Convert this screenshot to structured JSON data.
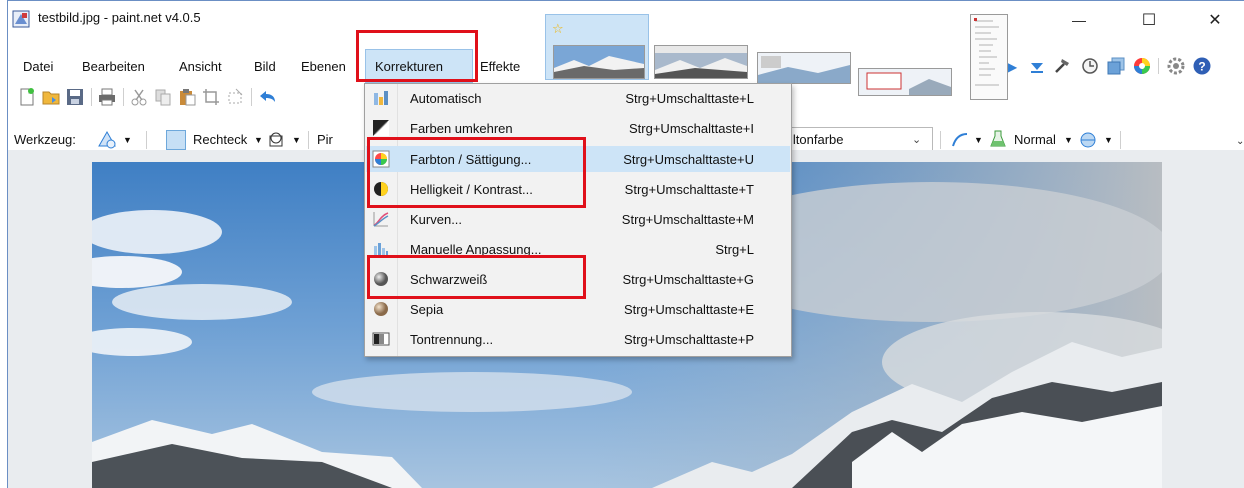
{
  "window": {
    "title": "testbild.jpg - paint.net v4.0.5",
    "minimize_glyph": "—",
    "maximize_glyph": "☐",
    "close_glyph": "✕"
  },
  "menubar": {
    "items": [
      {
        "label": "Datei"
      },
      {
        "label": "Bearbeiten"
      },
      {
        "label": "Ansicht"
      },
      {
        "label": "Bild"
      },
      {
        "label": "Ebenen"
      },
      {
        "label": "Korrekturen"
      },
      {
        "label": "Effekte"
      }
    ]
  },
  "tool_options": {
    "werkzeug_label": "Werkzeug:",
    "shape_label": "Rechteck",
    "pinsel_partial": "Pir",
    "fill_value": "lltonfarbe",
    "blend_value": "Normal"
  },
  "dropdown": {
    "items": [
      {
        "label": "Automatisch",
        "shortcut": "Strg+Umschalttaste+L",
        "icon": "auto-level-icon"
      },
      {
        "label": "Farben umkehren",
        "shortcut": "Strg+Umschalttaste+I",
        "icon": "invert-colors-icon"
      },
      {
        "label": "Farbton / Sättigung...",
        "shortcut": "Strg+Umschalttaste+U",
        "icon": "hue-saturation-icon"
      },
      {
        "label": "Helligkeit / Kontrast...",
        "shortcut": "Strg+Umschalttaste+T",
        "icon": "brightness-contrast-icon"
      },
      {
        "label": "Kurven...",
        "shortcut": "Strg+Umschalttaste+M",
        "icon": "curves-icon"
      },
      {
        "label": "Manuelle Anpassung...",
        "shortcut": "Strg+L",
        "icon": "levels-icon"
      },
      {
        "label": "Schwarzweiß",
        "shortcut": "Strg+Umschalttaste+G",
        "icon": "black-white-icon"
      },
      {
        "label": "Sepia",
        "shortcut": "Strg+Umschalttaste+E",
        "icon": "sepia-icon"
      },
      {
        "label": "Tontrennung...",
        "shortcut": "Strg+Umschalttaste+P",
        "icon": "posterize-icon"
      }
    ]
  },
  "colors": {
    "highlight": "#cde4f7",
    "annotation_red": "#e0101a",
    "sky_top": "#3f7fc4",
    "accent_blue": "#2f7fd6"
  }
}
